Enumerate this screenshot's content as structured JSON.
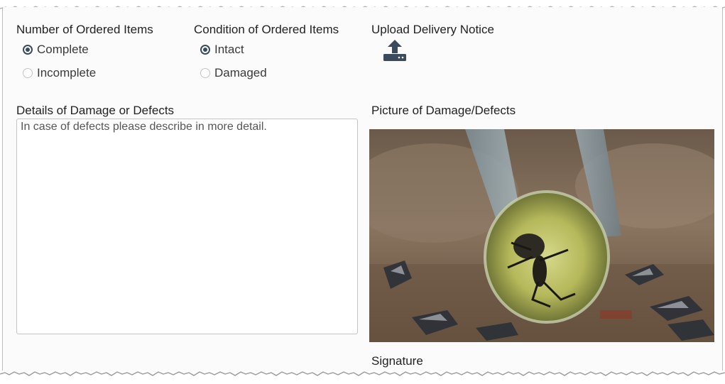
{
  "form": {
    "quantity": {
      "label": "Number of Ordered Items",
      "options": [
        {
          "label": "Complete",
          "checked": true
        },
        {
          "label": "Incomplete",
          "checked": false
        }
      ]
    },
    "condition": {
      "label": "Condition of Ordered Items",
      "options": [
        {
          "label": "Intact",
          "checked": true
        },
        {
          "label": "Damaged",
          "checked": false
        }
      ]
    },
    "upload": {
      "label": "Upload Delivery Notice",
      "icon": "upload-icon"
    },
    "details": {
      "label": "Details of Damage or Defects",
      "placeholder": "In case of defects please describe in more detail."
    },
    "picture": {
      "label": "Picture of Damage/Defects"
    },
    "signature": {
      "label": "Signature"
    }
  },
  "colors": {
    "accent": "#3b4a5c",
    "border": "#c4c4c4",
    "background": "#fbfbfc"
  }
}
